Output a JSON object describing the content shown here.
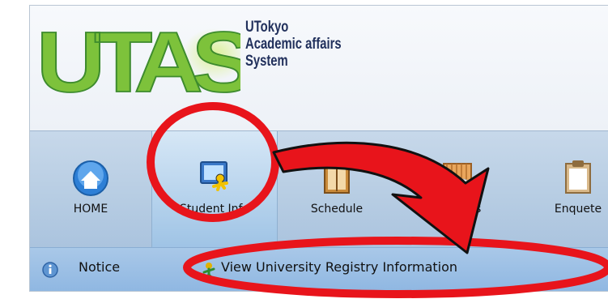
{
  "app": {
    "logo_text": "UTAS",
    "title_lines": [
      "UTokyo",
      "Academic affairs",
      "System"
    ]
  },
  "nav": {
    "tabs": [
      {
        "label": "HOME",
        "icon": "home-icon",
        "active": false
      },
      {
        "label": "Student Info",
        "icon": "student-info-icon",
        "active": true
      },
      {
        "label": "Schedule",
        "icon": "schedule-icon",
        "active": false
      },
      {
        "label": "Syllabus",
        "icon": "syllabus-icon",
        "active": false
      },
      {
        "label": "Enquete",
        "icon": "enquete-icon",
        "active": false
      }
    ]
  },
  "subnav": {
    "items": [
      {
        "label": "Notice",
        "icon": "info-icon"
      },
      {
        "label": "View University Registry Information",
        "icon": "person-icon"
      }
    ]
  },
  "annotation": {
    "color": "#e8141b",
    "marks": [
      "circle-highlight",
      "curved-arrow",
      "ellipse-highlight"
    ]
  },
  "colors": {
    "logo_green": "#7dc23b",
    "title_navy": "#21305c",
    "nav_blue": "#b7cde3",
    "subbar_blue": "#9bbfe5"
  }
}
